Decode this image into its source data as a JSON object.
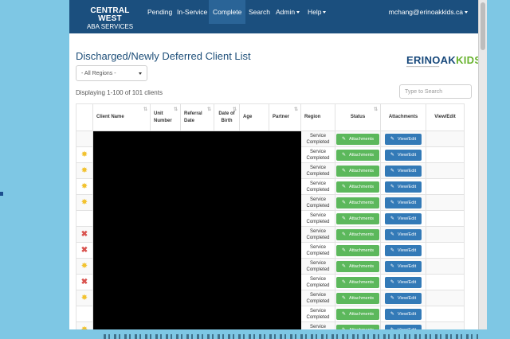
{
  "navbar": {
    "brand_line1": "CENTRAL WEST",
    "brand_line2": "ABA SERVICES",
    "items": [
      "Pending",
      "In-Service",
      "Complete",
      "Search",
      "Admin",
      "Help"
    ],
    "active_item": "Complete",
    "user": "mchang@erinoakkids.ca"
  },
  "page": {
    "title": "Discharged/Newly Deferred Client List",
    "logo_text_main": "ERINOAK",
    "logo_text_kids": "KIDS",
    "region_select_value": "- All Regions -",
    "display_count": "Displaying 1-100 of 101 clients",
    "search_placeholder": "Type to Search"
  },
  "table": {
    "headers": {
      "client_name": "Client Name",
      "unit_number": "Unit Number",
      "referral_date": "Referral Date",
      "dob": "Date of Birth",
      "age": "Age",
      "partner": "Partner",
      "region": "Region",
      "status": "Status",
      "attachments": "Attachments",
      "view_edit": "View/Edit"
    },
    "status_text": "Service Completed",
    "attachments_label": "Attachments",
    "view_edit_label": "View/Edit",
    "rows": [
      {
        "icon": "none"
      },
      {
        "icon": "star"
      },
      {
        "icon": "star"
      },
      {
        "icon": "star"
      },
      {
        "icon": "star"
      },
      {
        "icon": "none"
      },
      {
        "icon": "x"
      },
      {
        "icon": "x"
      },
      {
        "icon": "star"
      },
      {
        "icon": "x"
      },
      {
        "icon": "star"
      },
      {
        "icon": "none"
      },
      {
        "icon": "star"
      }
    ]
  },
  "colors": {
    "navbar": "#1b4f7e",
    "active_nav": "#2a6497",
    "title": "#1e4f79",
    "green_button": "#5cb85c",
    "blue_button": "#337ab7",
    "star": "#f2c22f",
    "x_mark": "#d9534f",
    "background": "#7ec7e4"
  }
}
